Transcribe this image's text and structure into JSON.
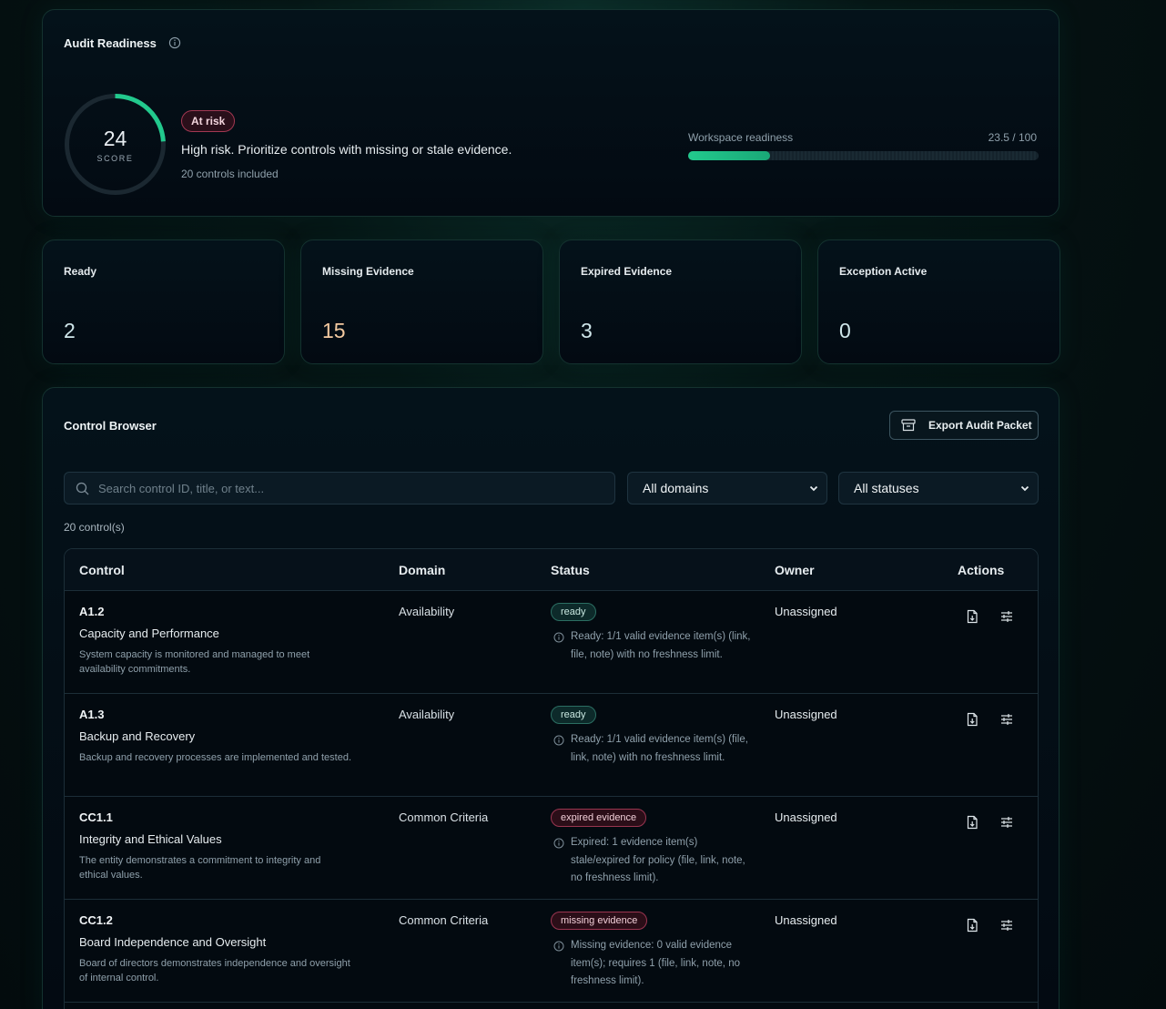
{
  "readiness": {
    "title": "Audit Readiness",
    "score": "24",
    "score_label": "SCORE",
    "score_fraction": 0.24,
    "risk_badge": "At risk",
    "risk_text": "High risk. Prioritize controls with missing or stale evidence.",
    "controls_included": "20 controls included",
    "progress_label": "Workspace readiness",
    "progress_value": "23.5 / 100",
    "progress_fraction": 0.235
  },
  "stats": [
    {
      "label": "Ready",
      "value": "2"
    },
    {
      "label": "Missing Evidence",
      "value": "15"
    },
    {
      "label": "Expired Evidence",
      "value": "3"
    },
    {
      "label": "Exception Active",
      "value": "0"
    }
  ],
  "browser": {
    "title": "Control Browser",
    "export_label": "Export Audit Packet",
    "search_placeholder": "Search control ID, title, or text...",
    "domain_select": "All domains",
    "status_select": "All statuses",
    "count": "20 control(s)",
    "headers": {
      "control": "Control",
      "domain": "Domain",
      "status": "Status",
      "owner": "Owner",
      "actions": "Actions"
    },
    "rows": [
      {
        "id": "A1.2",
        "title": "Capacity and Performance",
        "desc": "System capacity is monitored and managed to meet availability commitments.",
        "domain": "Availability",
        "status": "ready",
        "status_desc": "Ready: 1/1 valid evidence item(s) (link, file, note) with no freshness limit.",
        "owner": "Unassigned"
      },
      {
        "id": "A1.3",
        "title": "Backup and Recovery",
        "desc": "Backup and recovery processes are implemented and tested.",
        "domain": "Availability",
        "status": "ready",
        "status_desc": "Ready: 1/1 valid evidence item(s) (file, link, note) with no freshness limit.",
        "owner": "Unassigned"
      },
      {
        "id": "CC1.1",
        "title": "Integrity and Ethical Values",
        "desc": "The entity demonstrates a commitment to integrity and ethical values.",
        "domain": "Common Criteria",
        "status": "expired evidence",
        "status_desc": "Expired: 1 evidence item(s) stale/expired for policy (file, link, note, no freshness limit).",
        "owner": "Unassigned"
      },
      {
        "id": "CC1.2",
        "title": "Board Independence and Oversight",
        "desc": "Board of directors demonstrates independence and oversight of internal control.",
        "domain": "Common Criteria",
        "status": "missing evidence",
        "status_desc": "Missing evidence: 0 valid evidence item(s); requires 1 (file, link, note, no freshness limit).",
        "owner": "Unassigned"
      }
    ]
  },
  "colors": {
    "accent": "#22c98d",
    "danger": "#a33852",
    "ready": "#2b6e62"
  }
}
